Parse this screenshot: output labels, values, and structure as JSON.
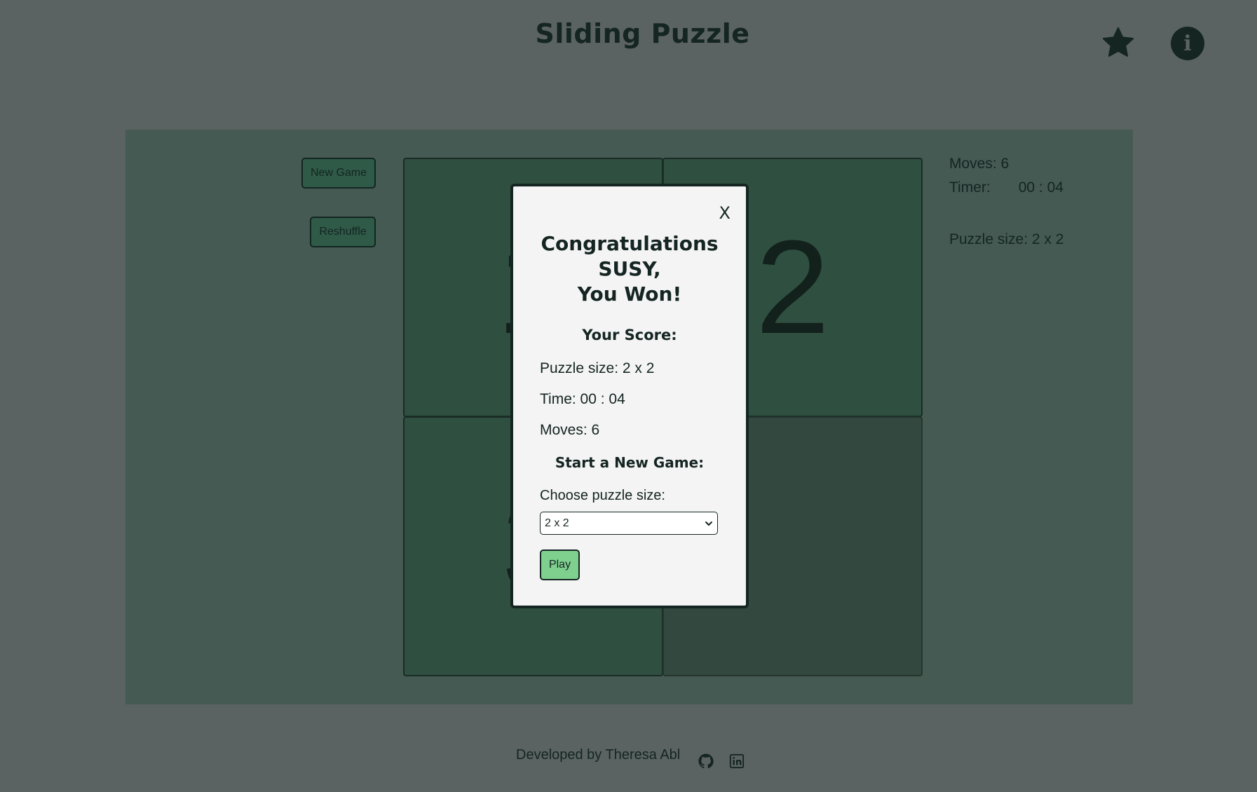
{
  "header": {
    "title": "Sliding Puzzle",
    "star_icon": "star-icon",
    "info_icon": "info-icon",
    "info_glyph": "i"
  },
  "controls": {
    "new_game_label": "New Game",
    "reshuffle_label": "Reshuffle"
  },
  "board": {
    "tiles": [
      "1",
      "2",
      "3",
      ""
    ]
  },
  "stats": {
    "moves": "Moves: 6",
    "timer_label": "Timer:",
    "timer_value": "00 : 04",
    "puzzle_size": "Puzzle size: 2 x 2"
  },
  "modal": {
    "close_label": "X",
    "congrats_line1": "Congratulations",
    "congrats_line2": "SUSY,",
    "congrats_line3": "You Won!",
    "score_heading": "Your Score:",
    "score_size": "Puzzle size: 2 x 2",
    "score_time": "Time: 00 : 04",
    "score_moves": "Moves: 6",
    "new_game_heading": "Start a New Game:",
    "choose_label": "Choose puzzle size:",
    "size_selected": "2 x 2",
    "play_label": "Play"
  },
  "footer": {
    "credit": "Developed by Theresa Abl",
    "github_icon": "github-icon",
    "linkedin_icon": "linkedin-icon"
  },
  "colors": {
    "page_bg": "#5a6362",
    "board_bg": "#455a52",
    "tile_bg": "#2f5040",
    "play_button": "#7fcf8e",
    "dark": "#142522"
  }
}
